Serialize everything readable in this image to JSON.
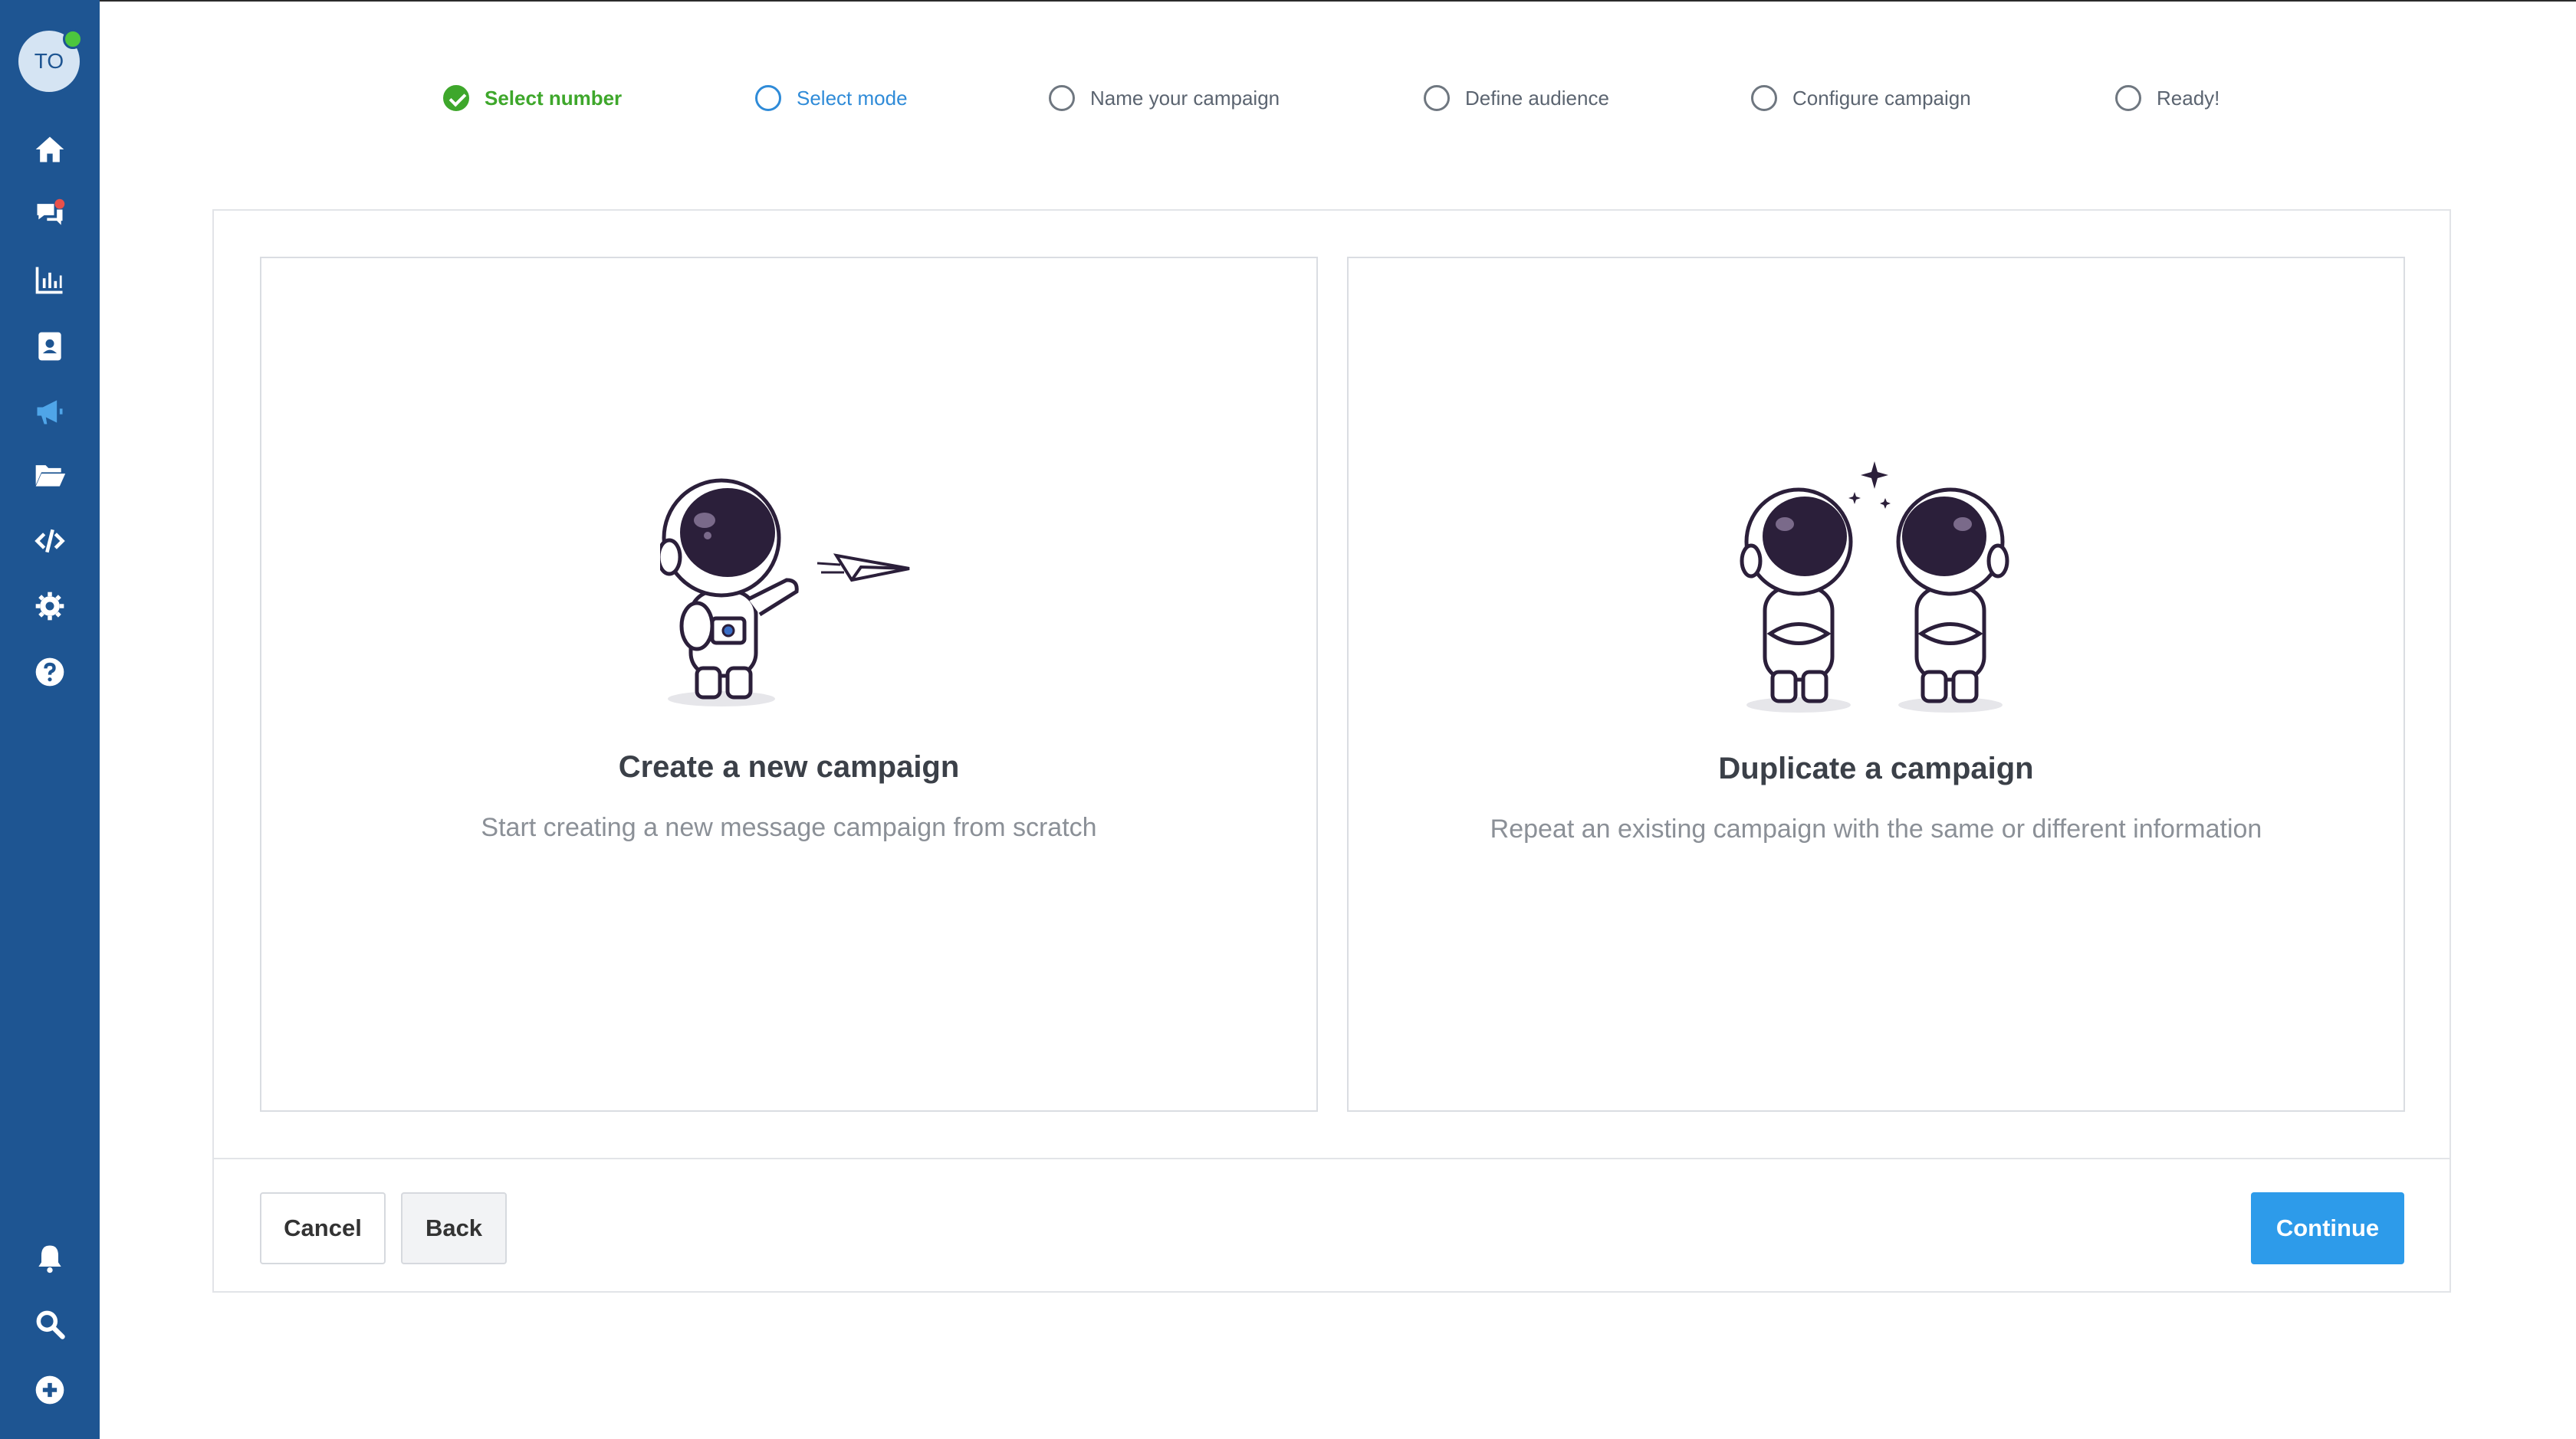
{
  "sidebar": {
    "avatar_initials": "TO",
    "nav_items": [
      "home",
      "conversations",
      "reports",
      "contacts",
      "campaigns",
      "files",
      "developer",
      "settings",
      "help"
    ],
    "bottom_items": [
      "notifications",
      "search",
      "add"
    ]
  },
  "stepper": {
    "steps": [
      {
        "label": "Select number",
        "state": "done"
      },
      {
        "label": "Select mode",
        "state": "active"
      },
      {
        "label": "Name your campaign",
        "state": "pending"
      },
      {
        "label": "Define audience",
        "state": "pending"
      },
      {
        "label": "Configure campaign",
        "state": "pending"
      },
      {
        "label": "Ready!",
        "state": "pending"
      }
    ]
  },
  "options": {
    "create": {
      "title": "Create a new campaign",
      "description": "Start creating a new message campaign from scratch"
    },
    "duplicate": {
      "title": "Duplicate a campaign",
      "description": "Repeat an existing campaign with the same or different information"
    }
  },
  "footer": {
    "cancel_label": "Cancel",
    "back_label": "Back",
    "continue_label": "Continue"
  },
  "colors": {
    "sidebar": "#1e5592",
    "done": "#3ea72b",
    "active": "#2f8bd8",
    "primary_button": "#2d9bea",
    "notification_dot": "#e8504a",
    "online_dot": "#4cc63d"
  }
}
